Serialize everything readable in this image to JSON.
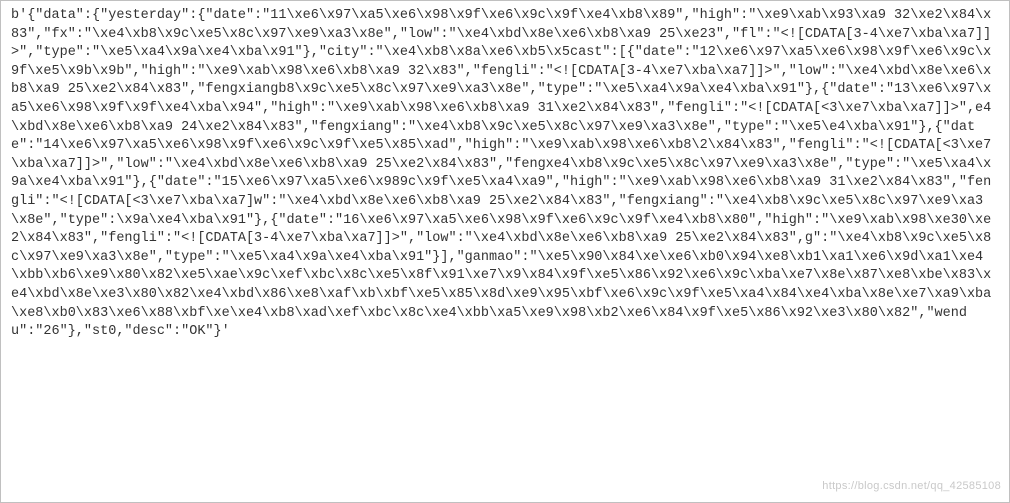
{
  "raw_bytes_dump": "b'{\"data\":{\"yesterday\":{\"date\":\"11\\xe6\\x97\\xa5\\xe6\\x98\\x9f\\xe6\\x9c\\x9f\\xe4\\xb8\\x89\",\"high\":\"\\xe9\\xab\\x93\\xa9 32\\xe2\\x84\\x83\",\"fx\":\"\\xe4\\xb8\\x9c\\xe5\\x8c\\x97\\xe9\\xa3\\x8e\",\"low\":\"\\xe4\\xbd\\x8e\\xe6\\xb8\\xa9 25\\xe23\",\"fl\":\"<![CDATA[3-4\\xe7\\xba\\xa7]]>\",\"type\":\"\\xe5\\xa4\\x9a\\xe4\\xba\\x91\"},\"city\":\"\\xe4\\xb8\\x8a\\xe6\\xb5\\x5cast\":[{\"date\":\"12\\xe6\\x97\\xa5\\xe6\\x98\\x9f\\xe6\\x9c\\x9f\\xe5\\x9b\\x9b\",\"high\":\"\\xe9\\xab\\x98\\xe6\\xb8\\xa9 32\\x83\",\"fengli\":\"<![CDATA[3-4\\xe7\\xba\\xa7]]>\",\"low\":\"\\xe4\\xbd\\x8e\\xe6\\xb8\\xa9 25\\xe2\\x84\\x83\",\"fengxiangb8\\x9c\\xe5\\x8c\\x97\\xe9\\xa3\\x8e\",\"type\":\"\\xe5\\xa4\\x9a\\xe4\\xba\\x91\"},{\"date\":\"13\\xe6\\x97\\xa5\\xe6\\x98\\x9f\\x9f\\xe4\\xba\\x94\",\"high\":\"\\xe9\\xab\\x98\\xe6\\xb8\\xa9 31\\xe2\\x84\\x83\",\"fengli\":\"<![CDATA[<3\\xe7\\xba\\xa7]]>\",e4\\xbd\\x8e\\xe6\\xb8\\xa9 24\\xe2\\x84\\x83\",\"fengxiang\":\"\\xe4\\xb8\\x9c\\xe5\\x8c\\x97\\xe9\\xa3\\x8e\",\"type\":\"\\xe5\\e4\\xba\\x91\"},{\"date\":\"14\\xe6\\x97\\xa5\\xe6\\x98\\x9f\\xe6\\x9c\\x9f\\xe5\\x85\\xad\",\"high\":\"\\xe9\\xab\\x98\\xe6\\xb8\\2\\x84\\x83\",\"fengli\":\"<![CDATA[<3\\xe7\\xba\\xa7]]>\",\"low\":\"\\xe4\\xbd\\x8e\\xe6\\xb8\\xa9 25\\xe2\\x84\\x83\",\"fengxe4\\xb8\\x9c\\xe5\\x8c\\x97\\xe9\\xa3\\x8e\",\"type\":\"\\xe5\\xa4\\x9a\\xe4\\xba\\x91\"},{\"date\":\"15\\xe6\\x97\\xa5\\xe6\\x989c\\x9f\\xe5\\xa4\\xa9\",\"high\":\"\\xe9\\xab\\x98\\xe6\\xb8\\xa9 31\\xe2\\x84\\x83\",\"fengli\":\"<![CDATA[<3\\xe7\\xba\\xa7]w\":\"\\xe4\\xbd\\x8e\\xe6\\xb8\\xa9 25\\xe2\\x84\\x83\",\"fengxiang\":\"\\xe4\\xb8\\x9c\\xe5\\x8c\\x97\\xe9\\xa3\\x8e\",\"type\":\\x9a\\xe4\\xba\\x91\"},{\"date\":\"16\\xe6\\x97\\xa5\\xe6\\x98\\x9f\\xe6\\x9c\\x9f\\xe4\\xb8\\x80\",\"high\":\"\\xe9\\xab\\x98\\xe30\\xe2\\x84\\x83\",\"fengli\":\"<![CDATA[3-4\\xe7\\xba\\xa7]]>\",\"low\":\"\\xe4\\xbd\\x8e\\xe6\\xb8\\xa9 25\\xe2\\x84\\x83\",g\":\"\\xe4\\xb8\\x9c\\xe5\\x8c\\x97\\xe9\\xa3\\x8e\",\"type\":\"\\xe5\\xa4\\x9a\\xe4\\xba\\x91\"}],\"ganmao\":\"\\xe5\\x90\\x84\\xe\\xe6\\xb0\\x94\\xe8\\xb1\\xa1\\xe6\\x9d\\xa1\\xe4\\xbb\\xb6\\xe9\\x80\\x82\\xe5\\xae\\x9c\\xef\\xbc\\x8c\\xe5\\x8f\\x91\\xe7\\x9\\x84\\x9f\\xe5\\x86\\x92\\xe6\\x9c\\xba\\xe7\\x8e\\x87\\xe8\\xbe\\x83\\xe4\\xbd\\x8e\\xe3\\x80\\x82\\xe4\\xbd\\x86\\xe8\\xaf\\xb\\xbf\\xe5\\x85\\x8d\\xe9\\x95\\xbf\\xe6\\x9c\\x9f\\xe5\\xa4\\x84\\xe4\\xba\\x8e\\xe7\\xa9\\xba\\xe8\\xb0\\x83\\xe6\\x88\\xbf\\xe\\xe4\\xb8\\xad\\xef\\xbc\\x8c\\xe4\\xbb\\xa5\\xe9\\x98\\xb2\\xe6\\x84\\x9f\\xe5\\x86\\x92\\xe3\\x80\\x82\",\"wendu\":\"26\"},\"st0,\"desc\":\"OK\"}'",
  "watermark_text": "https://blog.csdn.net/qq_42585108"
}
